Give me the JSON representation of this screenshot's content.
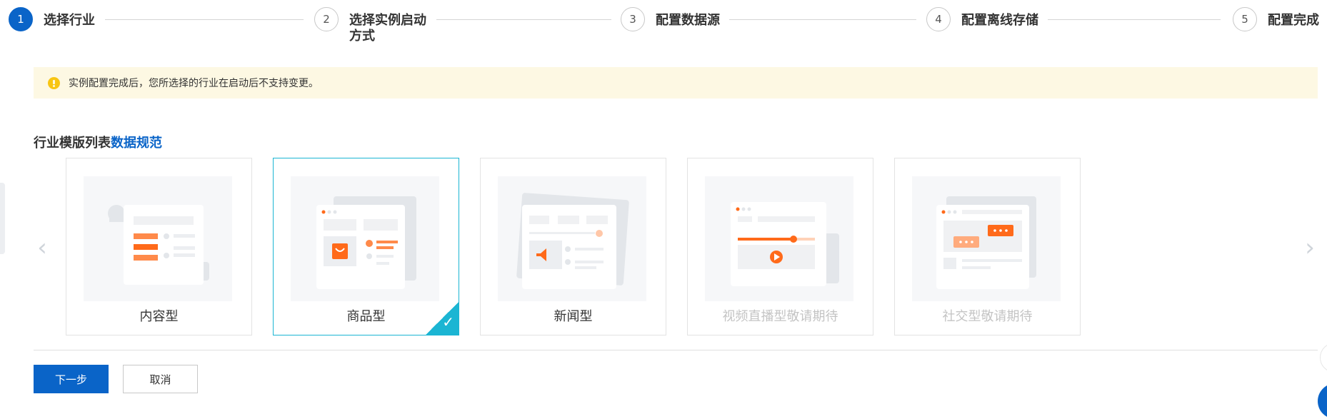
{
  "steps": [
    {
      "num": "1",
      "label": "选择行业"
    },
    {
      "num": "2",
      "label": "选择实例启动方式"
    },
    {
      "num": "3",
      "label": "配置数据源"
    },
    {
      "num": "4",
      "label": "配置离线存储"
    },
    {
      "num": "5",
      "label": "配置完成"
    }
  ],
  "notice": {
    "text": "实例配置完成后，您所选择的行业在启动后不支持变更。"
  },
  "section": {
    "title": "行业模版列表",
    "link": "数据规范"
  },
  "cards": [
    {
      "name": "内容型",
      "state": "normal"
    },
    {
      "name": "商品型",
      "state": "selected"
    },
    {
      "name": "新闻型",
      "state": "normal"
    },
    {
      "name": "视频直播型敬请期待",
      "state": "disabled"
    },
    {
      "name": "社交型敬请期待",
      "state": "disabled"
    }
  ],
  "buttons": {
    "next": "下一步",
    "cancel": "取消"
  },
  "icons": {
    "left_arrow": "chevron-left-icon",
    "right_arrow": "chevron-right-icon",
    "check": "check-icon",
    "warning": "warning-icon"
  },
  "colors": {
    "primary": "#0a64c8",
    "selected_border": "#1bb5d3",
    "notice_bg": "#fdf8e3",
    "accent_orange": "#ff6a1a"
  }
}
